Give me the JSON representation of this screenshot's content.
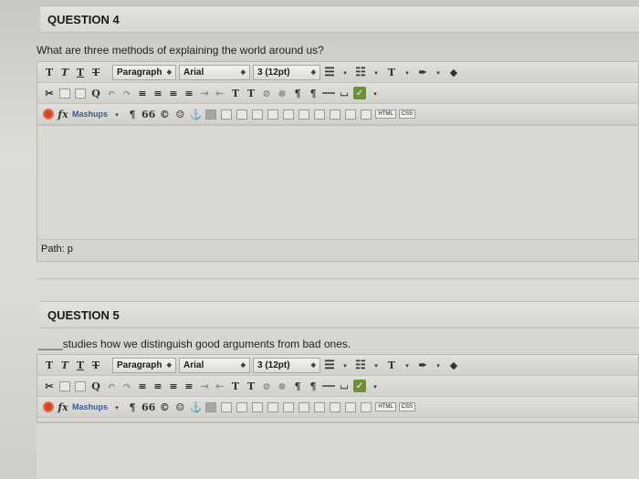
{
  "questions": [
    {
      "header": "QUESTION 4",
      "text": "What are three methods of explaining the world around us?",
      "path_label": "Path: p"
    },
    {
      "header": "QUESTION 5",
      "text": "____studies how we distinguish good arguments from bad ones.",
      "path_label": ""
    }
  ],
  "toolbar": {
    "format_buttons": [
      "T",
      "T",
      "T",
      "T"
    ],
    "paragraph": "Paragraph",
    "font": "Arial",
    "size": "3 (12pt)",
    "text_color": "T",
    "superscript": "T",
    "subscript": "T",
    "mashups": "Mashups",
    "pilcrow": "¶",
    "quote": "66",
    "copyright": "©",
    "fx": "fx",
    "html": "HTML",
    "css": "CSS"
  }
}
